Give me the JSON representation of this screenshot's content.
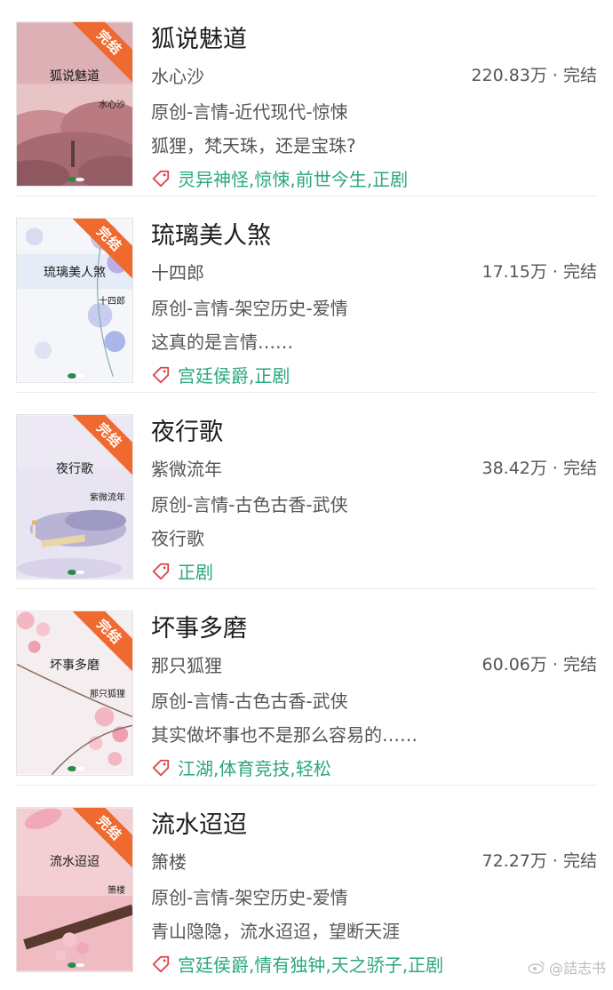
{
  "books": [
    {
      "title": "狐说魅道",
      "author": "水心沙",
      "stats": "220.83万 · 完结",
      "category": "原创-言情-近代现代-惊悚",
      "description": "狐狸，梵天珠，还是宝珠?",
      "tags": "灵异神怪,惊悚,前世今生,正剧",
      "cover_title": "狐说魅道",
      "cover_author": "水心沙",
      "badge": "完结"
    },
    {
      "title": "琉璃美人煞",
      "author": "十四郎",
      "stats": "17.15万 · 完结",
      "category": "原创-言情-架空历史-爱情",
      "description": "这真的是言情……",
      "tags": "宫廷侯爵,正剧",
      "cover_title": "琉璃美人煞",
      "cover_author": "十四郎",
      "badge": "完结"
    },
    {
      "title": "夜行歌",
      "author": "紫微流年",
      "stats": "38.42万 · 完结",
      "category": "原创-言情-古色古香-武侠",
      "description": "夜行歌",
      "tags": "正剧",
      "cover_title": "夜行歌",
      "cover_author": "紫微流年",
      "badge": "完结"
    },
    {
      "title": "坏事多磨",
      "author": "那只狐狸",
      "stats": "60.06万 · 完结",
      "category": "原创-言情-古色古香-武侠",
      "description": "其实做坏事也不是那么容易的……",
      "tags": "江湖,体育竞技,轻松",
      "cover_title": "坏事多磨",
      "cover_author": "那只狐狸",
      "badge": "完结"
    },
    {
      "title": "流水迢迢",
      "author": "箫楼",
      "stats": "72.27万 · 完结",
      "category": "原创-言情-架空历史-爱情",
      "description": "青山隐隐，流水迢迢，望断天涯",
      "tags": "宫廷侯爵,情有独钟,天之骄子,正剧",
      "cover_title": "流水迢迢",
      "cover_author": "箫楼",
      "badge": "完结"
    }
  ],
  "watermark": "@詰志书",
  "colors": {
    "tag_green": "#2aa87c",
    "badge_orange": "#f0692e",
    "tag_icon_red": "#e0414a"
  }
}
